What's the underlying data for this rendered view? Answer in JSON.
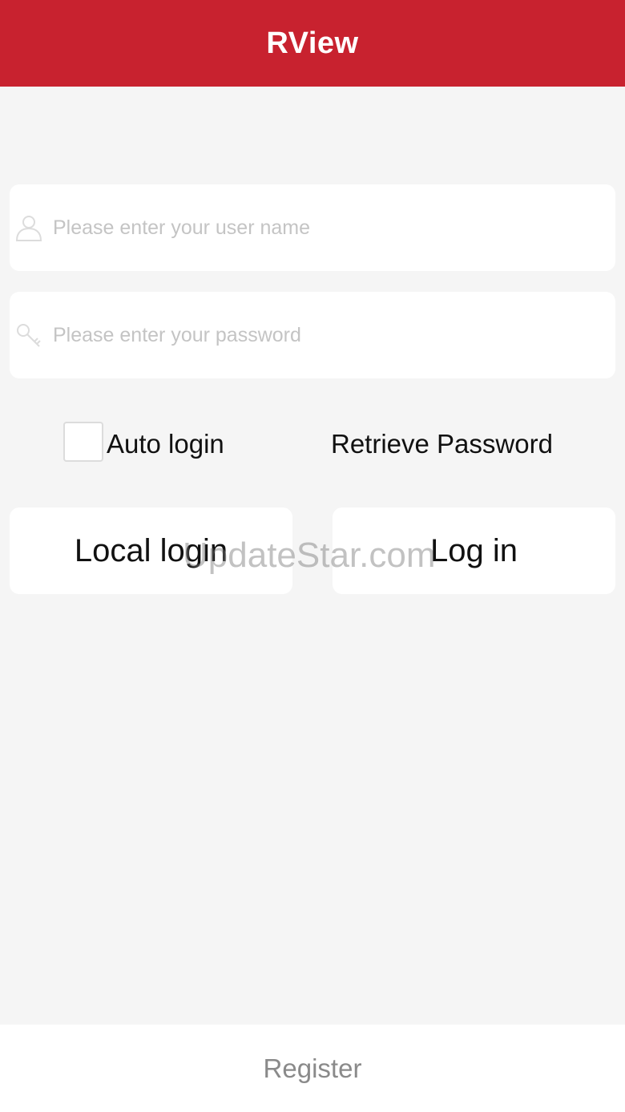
{
  "header": {
    "title": "RView",
    "background_color": "#c8222f"
  },
  "form": {
    "username": {
      "placeholder": "Please enter your user name",
      "value": "",
      "icon": "user-icon"
    },
    "password": {
      "placeholder": "Please enter your password",
      "value": "",
      "icon": "key-icon"
    },
    "auto_login": {
      "label": "Auto login",
      "checked": false
    },
    "retrieve_password_label": "Retrieve Password"
  },
  "buttons": {
    "local_login_label": "Local login",
    "login_label": "Log in"
  },
  "watermark": "UpdateStar.com",
  "footer": {
    "register_label": "Register"
  }
}
